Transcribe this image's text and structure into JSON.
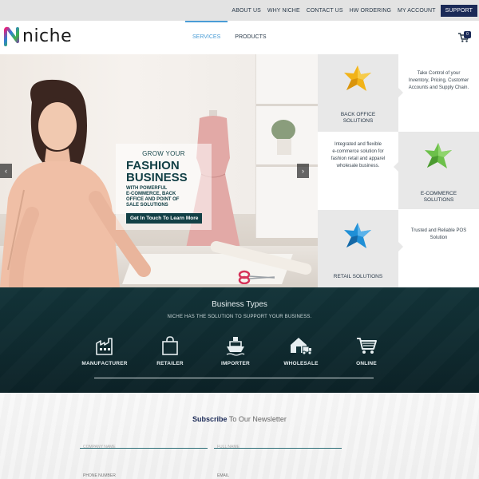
{
  "topbar": {
    "links": [
      "ABOUT US",
      "WHY NICHE",
      "CONTACT US",
      "HW ORDERING",
      "MY ACCOUNT"
    ],
    "support_label": "SUPPORT"
  },
  "brand": {
    "name": "niche"
  },
  "nav": {
    "items": [
      {
        "label": "SERVICES",
        "active": true
      },
      {
        "label": "PRODUCTS",
        "active": false
      }
    ],
    "cart_count": "0"
  },
  "hero": {
    "kicker": "GROW YOUR",
    "headline_line1": "FASHION",
    "headline_line2": "BUSINESS",
    "subline1": "WITH POWERFUL",
    "subline2": "E-COMMERCE, BACK",
    "subline3": "OFFICE AND POINT OF",
    "subline4": "SALE SOLUTIONS",
    "cta_label": "Get In Touch To Learn More",
    "prev_glyph": "‹",
    "next_glyph": "›"
  },
  "solutions": {
    "back_office": {
      "title_line1": "BACK OFFICE",
      "title_line2": "SOLUTIONS",
      "desc_line1": "Take Control of your",
      "desc_line2": "Inventory, Pricing, Customer",
      "desc_line3": "Accounts and Supply Chain.",
      "color": "#f2b318"
    },
    "ecommerce": {
      "title_line1": "E-COMMERCE",
      "title_line2": "SOLUTIONS",
      "desc_line1": "Integrated and flexible",
      "desc_line2": "e-commerce solution for",
      "desc_line3": "fashion retail and apparel",
      "desc_line4": "wholesale business.",
      "color": "#6cc04a"
    },
    "retail": {
      "title": "RETAIL SOLUTIONS",
      "desc_line1": "Trusted and Reliable POS",
      "desc_line2": "Solution",
      "color": "#1f8fd6"
    }
  },
  "business_types": {
    "title": "Business Types",
    "subtitle": "NICHE HAS THE SOLUTION TO SUPPORT YOUR BUSINESS.",
    "items": [
      {
        "label": "MANUFACTURER",
        "icon": "factory-icon"
      },
      {
        "label": "RETAILER",
        "icon": "shopping-bag-icon"
      },
      {
        "label": "IMPORTER",
        "icon": "ship-icon"
      },
      {
        "label": "WHOLESALE",
        "icon": "warehouse-truck-icon"
      },
      {
        "label": "ONLINE",
        "icon": "shopping-cart-icon"
      }
    ]
  },
  "newsletter": {
    "title_bold": "Subscribe",
    "title_rest": " To Our Newsletter",
    "company_placeholder": "COMPANY NAME",
    "fullname_placeholder": "FULL NAME",
    "phone_placeholder": "PHONE NUMBER",
    "email_placeholder": "EMAIL"
  },
  "colors": {
    "navy": "#1b2a57",
    "teal_dark": "#124046",
    "active_blue": "#4a9cd6"
  }
}
